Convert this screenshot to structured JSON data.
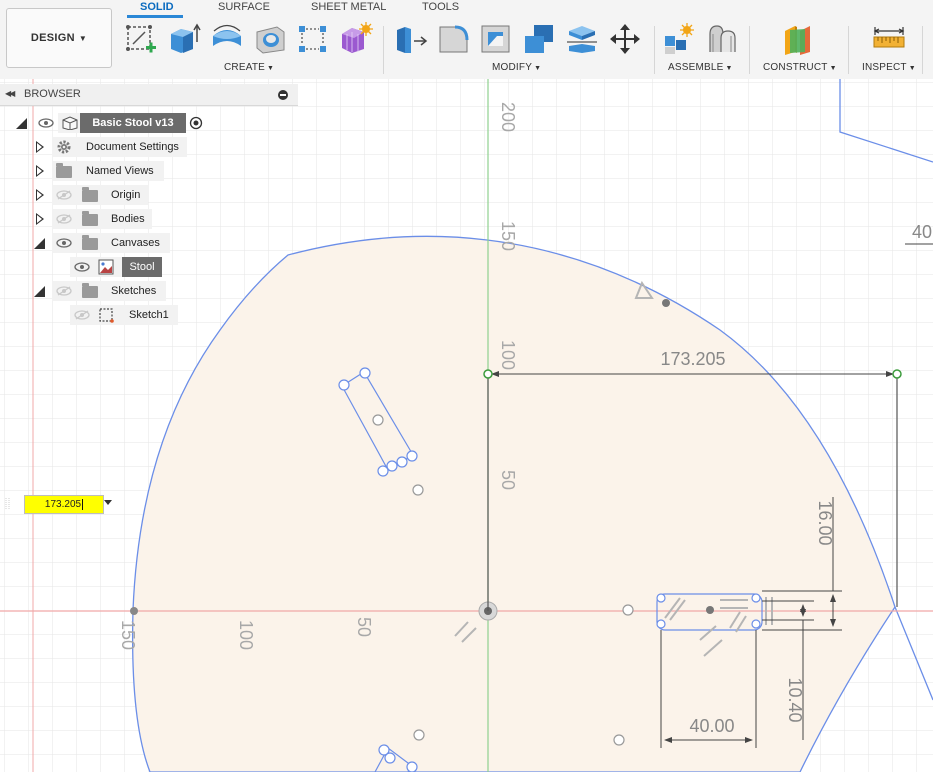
{
  "app": {
    "workspace_label": "DESIGN",
    "tabs": [
      {
        "label": "SOLID",
        "active": true
      },
      {
        "label": "SURFACE",
        "active": false
      },
      {
        "label": "SHEET METAL",
        "active": false
      },
      {
        "label": "TOOLS",
        "active": false
      }
    ],
    "groups": {
      "create": "CREATE",
      "modify": "MODIFY",
      "assemble": "ASSEMBLE",
      "construct": "CONSTRUCT",
      "inspect": "INSPECT"
    },
    "accent_color": "#2a87d6"
  },
  "browser": {
    "title": "BROWSER",
    "items": [
      {
        "label": "Basic Stool v13",
        "kind": "root"
      },
      {
        "label": "Document Settings",
        "kind": "settings"
      },
      {
        "label": "Named Views",
        "kind": "folder"
      },
      {
        "label": "Origin",
        "kind": "folder"
      },
      {
        "label": "Bodies",
        "kind": "folder"
      },
      {
        "label": "Canvases",
        "kind": "folder"
      },
      {
        "label": "Stool",
        "kind": "canvas"
      },
      {
        "label": "Sketches",
        "kind": "folder"
      },
      {
        "label": "Sketch1",
        "kind": "sketch"
      }
    ]
  },
  "dimension_input": {
    "value": "173.205"
  },
  "canvas": {
    "ruler_vertical": [
      "200",
      "150",
      "100",
      "50"
    ],
    "ruler_horizontal": [
      "150",
      "100",
      "50"
    ],
    "dimensions": {
      "width": "173.205",
      "height_16": "16.00",
      "height_1040": "10.40",
      "width_40": "40.00",
      "clipped": "40"
    }
  }
}
